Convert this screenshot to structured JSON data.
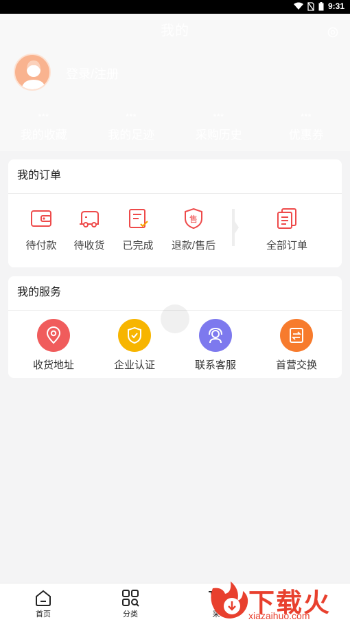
{
  "status_bar": {
    "time": "9:31"
  },
  "header": {
    "title": "我的",
    "login_text": "登录/注册",
    "stats": [
      {
        "value": "***",
        "label": "我的收藏"
      },
      {
        "value": "***",
        "label": "我的足迹"
      },
      {
        "value": "***",
        "label": "采购历史"
      },
      {
        "value": "***",
        "label": "优惠券"
      }
    ]
  },
  "orders": {
    "title": "我的订单",
    "items": [
      {
        "label": "待付款",
        "icon": "wallet-icon"
      },
      {
        "label": "待收货",
        "icon": "truck-icon"
      },
      {
        "label": "已完成",
        "icon": "completed-document-icon"
      },
      {
        "label": "退款/售后",
        "icon": "after-sale-shield-icon"
      },
      {
        "label": "全部订单",
        "icon": "all-orders-icon"
      }
    ],
    "after_sale_badge": "售"
  },
  "services": {
    "title": "我的服务",
    "items": [
      {
        "label": "收货地址",
        "icon": "location-pin-icon",
        "color": "#f05c5c"
      },
      {
        "label": "企业认证",
        "icon": "shield-check-icon",
        "color": "#f7b500"
      },
      {
        "label": "联系客服",
        "icon": "customer-service-icon",
        "color": "#7d79ee"
      },
      {
        "label": "首营交换",
        "icon": "exchange-icon",
        "color": "#f77b2d"
      }
    ]
  },
  "tabbar": {
    "items": [
      {
        "label": "首页",
        "icon": "home-icon"
      },
      {
        "label": "分类",
        "icon": "category-icon"
      },
      {
        "label": "采",
        "icon": "cart-icon"
      }
    ]
  },
  "watermark": {
    "text": "下载火",
    "domain": "xiazaihuo.com"
  },
  "colors": {
    "accent_red": "#f05c5c",
    "order_icon": "#ee4a4a",
    "page_bg": "#f4f4f5"
  }
}
